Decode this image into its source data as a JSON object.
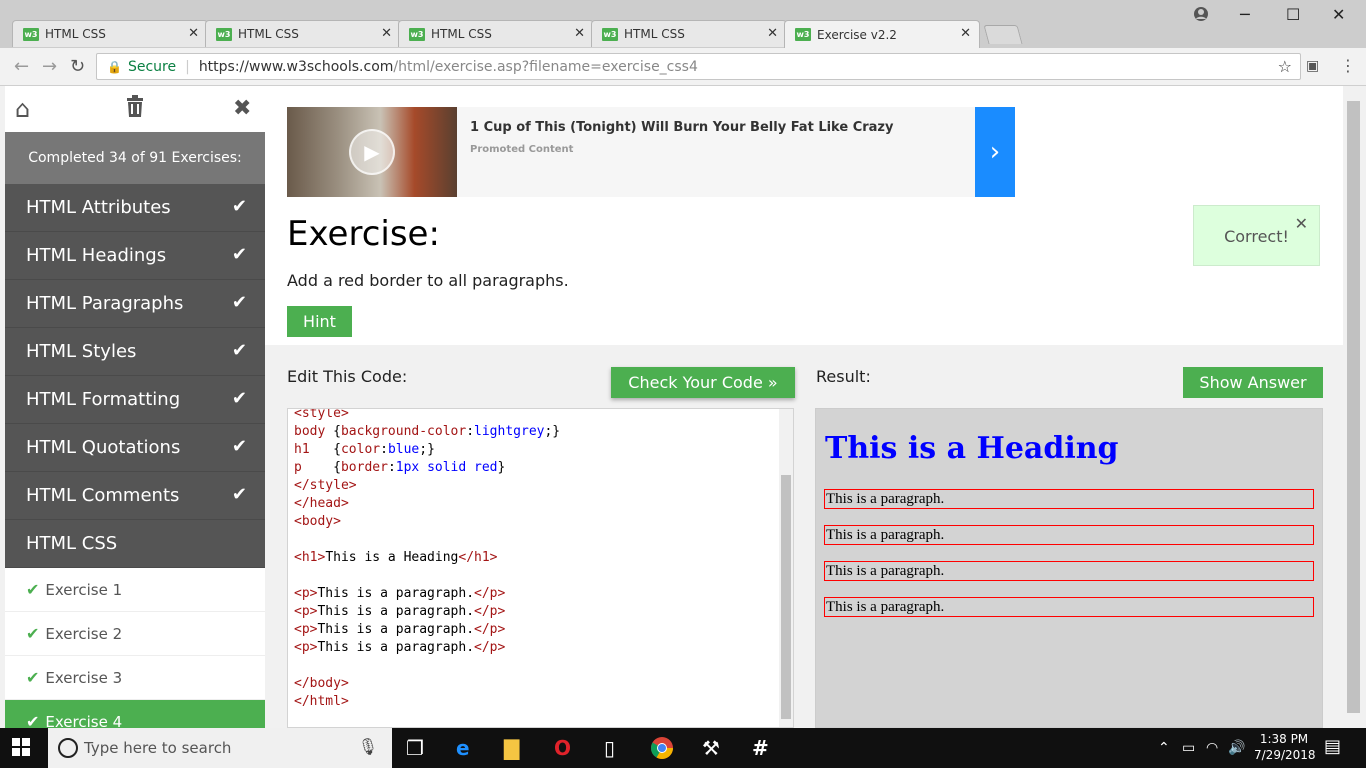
{
  "browser": {
    "tabs": [
      {
        "favicon": "w3",
        "title": "HTML CSS",
        "close": "✕"
      },
      {
        "favicon": "w3",
        "title": "HTML CSS",
        "close": "✕"
      },
      {
        "favicon": "w3",
        "title": "HTML CSS",
        "close": "✕"
      },
      {
        "favicon": "w3",
        "title": "HTML CSS",
        "close": "✕"
      },
      {
        "favicon": "w3",
        "title": "Exercise v2.2",
        "close": "✕"
      }
    ],
    "window_controls": {
      "minimize": "─",
      "maximize": "☐",
      "close": "✕"
    },
    "secure_label": "Secure",
    "url_host": "https://www.w3schools.com",
    "url_path": "/html/exercise.asp?filename=exercise_css4"
  },
  "sidebar": {
    "completed_text": "Completed 34 of 91 Exercises:",
    "sections": [
      {
        "label": "HTML Attributes",
        "done": true
      },
      {
        "label": "HTML Headings",
        "done": true
      },
      {
        "label": "HTML Paragraphs",
        "done": true
      },
      {
        "label": "HTML Styles",
        "done": true
      },
      {
        "label": "HTML Formatting",
        "done": true
      },
      {
        "label": "HTML Quotations",
        "done": true
      },
      {
        "label": "HTML Comments",
        "done": true
      },
      {
        "label": "HTML CSS",
        "done": false
      }
    ],
    "exercises": [
      {
        "label": "Exercise 1"
      },
      {
        "label": "Exercise 2"
      },
      {
        "label": "Exercise 3"
      },
      {
        "label": "Exercise 4"
      }
    ]
  },
  "ad": {
    "title": "1 Cup of This (Tonight) Will Burn Your Belly Fat Like Crazy",
    "subtitle": "Promoted Content"
  },
  "exercise": {
    "title": "Exercise:",
    "description": "Add a red border to all paragraphs.",
    "hint_label": "Hint",
    "correct_message": "Correct!",
    "edit_label": "Edit This Code:",
    "check_label": "Check Your Code »",
    "result_label": "Result:",
    "answer_label": "Show Answer"
  },
  "result": {
    "heading": "This is a Heading",
    "paragraphs": [
      "This is a paragraph.",
      "This is a paragraph.",
      "This is a paragraph.",
      "This is a paragraph."
    ]
  },
  "taskbar": {
    "search_placeholder": "Type here to search",
    "time": "1:38 PM",
    "date": "7/29/2018"
  }
}
